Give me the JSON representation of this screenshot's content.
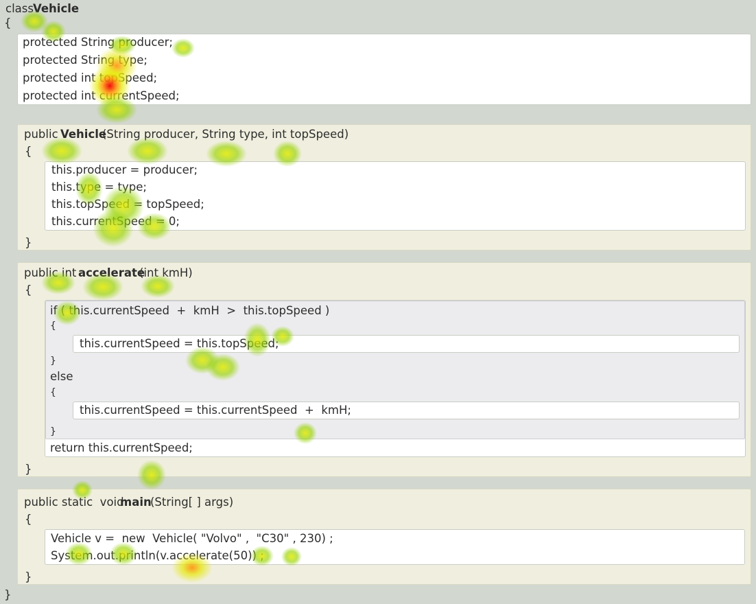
{
  "class_decl": {
    "keyword": "class",
    "name": "Vehicle",
    "open": "{",
    "close": "}"
  },
  "fields": [
    "protected String producer;",
    "protected String type;",
    "protected int topSpeed;",
    "protected int currentSpeed;"
  ],
  "constructor": {
    "signature_prefix": "public",
    "name": "Vehicle",
    "params": "(String producer, String type, int topSpeed)",
    "open": "{",
    "close": "}",
    "body": [
      "this.producer = producer;",
      "this.type = type;",
      "this.topSpeed = topSpeed;",
      "this.currentSpeed = 0;"
    ]
  },
  "accelerate": {
    "signature_prefix": "public int",
    "name": "accelerate",
    "params": "(int kmH)",
    "open": "{",
    "close": "}",
    "if_line": "if ( this.currentSpeed  +  kmH  >  this.topSpeed )",
    "if_open": "{",
    "if_body": "this.currentSpeed = this.topSpeed;",
    "if_close": "}",
    "else_kw": "else",
    "else_open": "{",
    "else_body": "this.currentSpeed = this.currentSpeed  +  kmH;",
    "else_close": "}",
    "return_line": "return this.currentSpeed;"
  },
  "main": {
    "signature_prefix": "public static  void",
    "name": "main",
    "params": "(String[ ] args)",
    "open": "{",
    "close": "}",
    "body": [
      "Vehicle v =  new  Vehicle( \"Volvo\" ,  \"C30\" , 230) ;",
      "System.out.println(v.accelerate(50)) ;"
    ]
  }
}
